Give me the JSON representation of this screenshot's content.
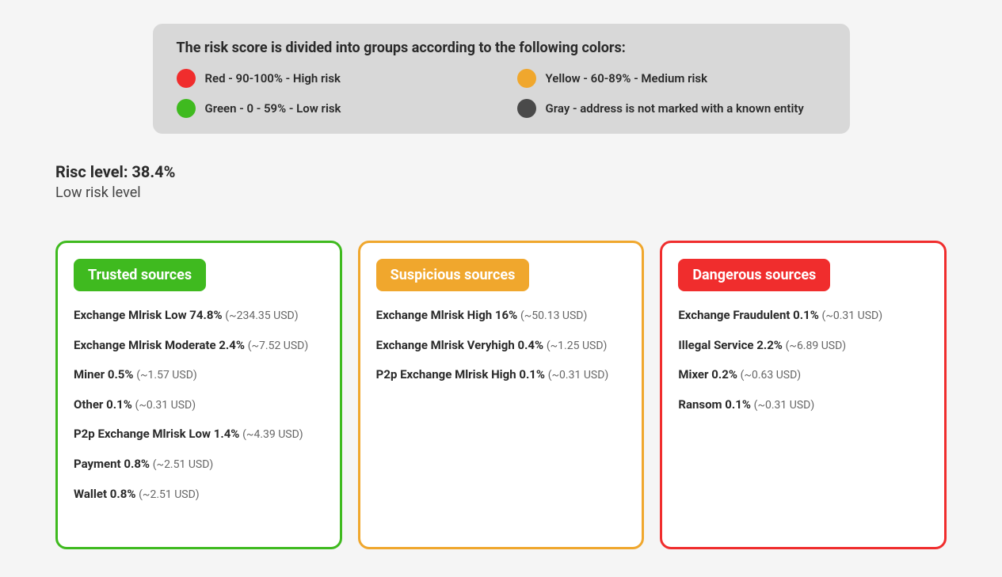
{
  "legend": {
    "title": "The risk score is divided into groups according to the following colors:",
    "items": [
      {
        "color": "#f02d2d",
        "label": "Red - 90-100% - High risk"
      },
      {
        "color": "#f0a72d",
        "label": "Yellow - 60-89% - Medium risk"
      },
      {
        "color": "#3fba1f",
        "label": "Green - 0 - 59% - Low risk"
      },
      {
        "color": "#4a4a4a",
        "label": "Gray - address is not marked with a known entity"
      }
    ]
  },
  "risk": {
    "value_line": "Risc level: 38.4%",
    "label": "Low risk level"
  },
  "cards": {
    "trusted": {
      "header": "Trusted sources",
      "items": [
        {
          "main": "Exchange Mlrisk Low 74.8%",
          "sub": "(~234.35 USD)"
        },
        {
          "main": "Exchange Mlrisk Moderate 2.4%",
          "sub": "(~7.52 USD)"
        },
        {
          "main": "Miner 0.5%",
          "sub": "(~1.57 USD)"
        },
        {
          "main": "Other 0.1%",
          "sub": "(~0.31 USD)"
        },
        {
          "main": "P2p Exchange Mlrisk Low 1.4%",
          "sub": "(~4.39 USD)"
        },
        {
          "main": "Payment 0.8%",
          "sub": "(~2.51 USD)"
        },
        {
          "main": "Wallet 0.8%",
          "sub": "(~2.51 USD)"
        }
      ]
    },
    "suspicious": {
      "header": "Suspicious sources",
      "items": [
        {
          "main": "Exchange Mlrisk High 16%",
          "sub": "(~50.13 USD)"
        },
        {
          "main": "Exchange Mlrisk Veryhigh 0.4%",
          "sub": "(~1.25 USD)"
        },
        {
          "main": "P2p Exchange Mlrisk High 0.1%",
          "sub": "(~0.31 USD)"
        }
      ]
    },
    "dangerous": {
      "header": "Dangerous sources",
      "items": [
        {
          "main": "Exchange Fraudulent 0.1%",
          "sub": "(~0.31 USD)"
        },
        {
          "main": "Illegal Service 2.2%",
          "sub": "(~6.89 USD)"
        },
        {
          "main": "Mixer 0.2%",
          "sub": "(~0.63 USD)"
        },
        {
          "main": "Ransom 0.1%",
          "sub": "(~0.31 USD)"
        }
      ]
    }
  }
}
